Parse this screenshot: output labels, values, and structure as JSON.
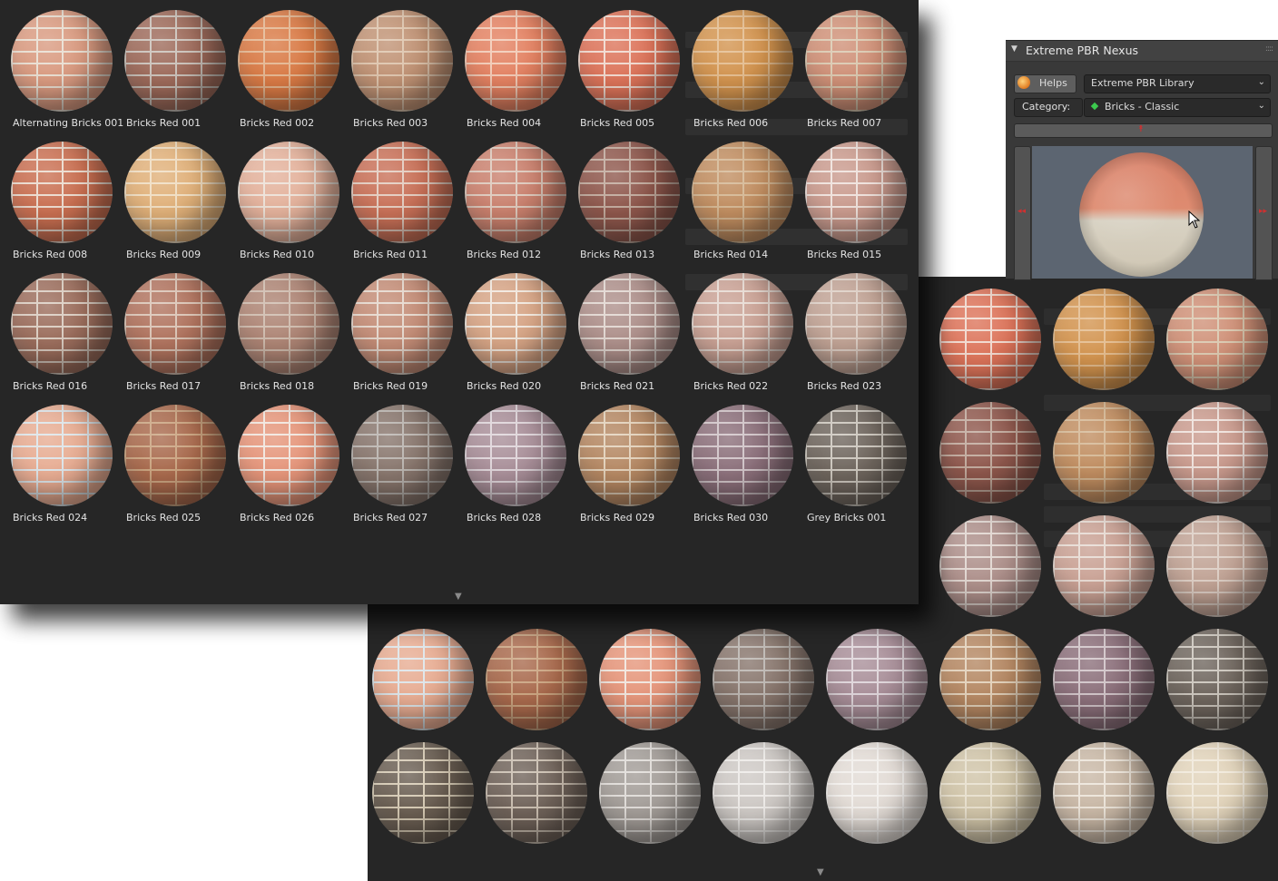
{
  "panel": {
    "title": "Extreme PBR Nexus",
    "helps_label": "Helps",
    "library_value": "Extreme PBR Library",
    "category_label": "Category:",
    "category_value": "Bricks - Classic"
  },
  "accent_color": "#d03030",
  "materials": [
    {
      "name": "Alternating Bricks 001",
      "color": "#d99a80",
      "mortar": "#e8ddd0"
    },
    {
      "name": "Bricks Red 001",
      "color": "#9d6a5a",
      "mortar": "#c9c0b8"
    },
    {
      "name": "Bricks Red 002",
      "color": "#d97a45",
      "mortar": "#e3b48e"
    },
    {
      "name": "Bricks Red 003",
      "color": "#c09274",
      "mortar": "#ddc3ab"
    },
    {
      "name": "Bricks Red 004",
      "color": "#e38161",
      "mortar": "#f1c8b3"
    },
    {
      "name": "Bricks Red 005",
      "color": "#dc7359",
      "mortar": "#f0d7cc"
    },
    {
      "name": "Bricks Red 006",
      "color": "#d2934e",
      "mortar": "#e3bb8d"
    },
    {
      "name": "Bricks Red 007",
      "color": "#cf9077",
      "mortar": "#d9c7ae"
    },
    {
      "name": "Bricks Red 008",
      "color": "#c96f51",
      "mortar": "#ead9cc"
    },
    {
      "name": "Bricks Red 009",
      "color": "#e0b079",
      "mortar": "#efdcc0"
    },
    {
      "name": "Bricks Red 010",
      "color": "#e3b19b",
      "mortar": "#ece0d6"
    },
    {
      "name": "Bricks Red 011",
      "color": "#c87057",
      "mortar": "#e2cabd"
    },
    {
      "name": "Bricks Red 012",
      "color": "#c9806d",
      "mortar": "#dcc7ba"
    },
    {
      "name": "Bricks Red 013",
      "color": "#8e574c",
      "mortar": "#bfa79a"
    },
    {
      "name": "Bricks Red 014",
      "color": "#c08d60",
      "mortar": "#d3b591"
    },
    {
      "name": "Bricks Red 015",
      "color": "#c99a8d",
      "mortar": "#eee0da"
    },
    {
      "name": "Bricks Red 016",
      "color": "#9b6d5c",
      "mortar": "#d9cbbf"
    },
    {
      "name": "Bricks Red 017",
      "color": "#b0735e",
      "mortar": "#d9c2b3"
    },
    {
      "name": "Bricks Red 018",
      "color": "#ad8474",
      "mortar": "#cdb9ab"
    },
    {
      "name": "Bricks Red 019",
      "color": "#c38c76",
      "mortar": "#e4d6cb"
    },
    {
      "name": "Bricks Red 020",
      "color": "#d6a485",
      "mortar": "#f0e6dc"
    },
    {
      "name": "Bricks Red 021",
      "color": "#ad8f8a",
      "mortar": "#e0d5cf"
    },
    {
      "name": "Bricks Red 022",
      "color": "#c9a194",
      "mortar": "#e6d9d1"
    },
    {
      "name": "Bricks Red 023",
      "color": "#c0a294",
      "mortar": "#dccdc3"
    },
    {
      "name": "Bricks Red 024",
      "color": "#e7ac92",
      "mortar": "#dce4e8"
    },
    {
      "name": "Bricks Red 025",
      "color": "#a8694c",
      "mortar": "#c9a27e"
    },
    {
      "name": "Bricks Red 026",
      "color": "#e5957a",
      "mortar": "#f0e4dc"
    },
    {
      "name": "Bricks Red 027",
      "color": "#87756c",
      "mortar": "#b8b2ad"
    },
    {
      "name": "Bricks Red 028",
      "color": "#a88e98",
      "mortar": "#ddd3d8"
    },
    {
      "name": "Bricks Red 029",
      "color": "#b48762",
      "mortar": "#e1cfb8"
    },
    {
      "name": "Bricks Red 030",
      "color": "#8b6f7a",
      "mortar": "#cfc2c6"
    },
    {
      "name": "Grey Bricks 001",
      "color": "#6e655d",
      "mortar": "#cac4bb"
    }
  ],
  "back_spheres": [
    {
      "color": "#dc7359",
      "mortar": "#f0d7cc"
    },
    {
      "color": "#d2934e",
      "mortar": "#e3bb8d"
    },
    {
      "color": "#cf9077",
      "mortar": "#d9c7ae"
    },
    {
      "color": "#8e574c",
      "mortar": "#bfa79a"
    },
    {
      "color": "#c08d60",
      "mortar": "#d3b591"
    },
    {
      "color": "#c99a8d",
      "mortar": "#eee0da"
    },
    {
      "color": "#ad8f8a",
      "mortar": "#e0d5cf"
    },
    {
      "color": "#c9a194",
      "mortar": "#e6d9d1"
    },
    {
      "color": "#c0a294",
      "mortar": "#dccdc3"
    },
    {
      "color": "#e7ac92",
      "mortar": "#dce4e8"
    },
    {
      "color": "#a8694c",
      "mortar": "#c9a27e"
    },
    {
      "color": "#e5957a",
      "mortar": "#f0e4dc"
    },
    {
      "color": "#87756c",
      "mortar": "#b8b2ad"
    },
    {
      "color": "#a88e98",
      "mortar": "#ddd3d8"
    },
    {
      "color": "#b48762",
      "mortar": "#e1cfb8"
    },
    {
      "color": "#8b6f7a",
      "mortar": "#cfc2c6"
    },
    {
      "color": "#6e655d",
      "mortar": "#cac4bb"
    },
    {
      "color": "#6a5e52",
      "mortar": "#d4c8b2"
    },
    {
      "color": "#6f6259",
      "mortar": "#c8bcae"
    },
    {
      "color": "#a29c97",
      "mortar": "#dedad6"
    },
    {
      "color": "#cdc8c4",
      "mortar": "#ece9e6"
    },
    {
      "color": "#e2dbd5",
      "mortar": "#f2efec"
    },
    {
      "color": "#cfc3a7",
      "mortar": "#e6decb"
    },
    {
      "color": "#c8b7a5",
      "mortar": "#ebe3d8"
    },
    {
      "color": "#e1d3ba",
      "mortar": "#f0e8d9"
    }
  ]
}
